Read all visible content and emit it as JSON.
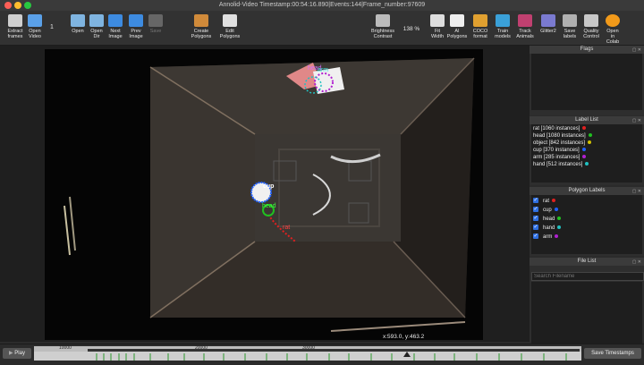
{
  "window": {
    "title": "Annolid-Video Timestamp:00:54:16.890|Events:144|Frame_number:97609"
  },
  "toolbar": {
    "extract_frames": "Extract\nframes",
    "open_video": "Open\nVideo",
    "frame_step": "1",
    "open": "Open",
    "open_dir": "Open\nDir",
    "next_image": "Next\nImage",
    "prev_image": "Prev\nImage",
    "save": "Save",
    "create_polygons": "Create\nPolygons",
    "edit_polygons": "Edit\nPolygons",
    "brightness_contrast": "Brightness\nContrast",
    "zoom": "138 %",
    "fit_width": "Fit\nWidth",
    "ai_polygons": "AI\nPolygons",
    "coco_format": "COCO\nformat",
    "train_models": "Train\nmodels",
    "track_animals": "Track\nAnimals",
    "glitter2": "Glitter2",
    "save_labels": "Save\nlabels",
    "quality_control": "Quality\nControl",
    "open_in_colab": "Open\nin\nColab"
  },
  "canvas": {
    "labels": {
      "head": "head",
      "cup": "cup",
      "rat": "rat",
      "arm": "arm"
    },
    "coords": "x:593.0, y:463.2"
  },
  "docks": {
    "flags": {
      "title": "Flags"
    },
    "label_list": {
      "title": "Label List",
      "items": [
        {
          "text": "rat [1060 instances]",
          "color": "#e02020"
        },
        {
          "text": "head [1080 instances]",
          "color": "#20c020"
        },
        {
          "text": "object [842 instances]",
          "color": "#d0c000"
        },
        {
          "text": "cup [370 instances]",
          "color": "#2060ff"
        },
        {
          "text": "arm [285 instances]",
          "color": "#b020d0"
        },
        {
          "text": "hand [512 instances]",
          "color": "#20c0c0"
        }
      ]
    },
    "polygon_labels": {
      "title": "Polygon Labels",
      "items": [
        {
          "text": "rat",
          "color": "#e02020"
        },
        {
          "text": "cup",
          "color": "#2060ff"
        },
        {
          "text": "head",
          "color": "#20c020"
        },
        {
          "text": "hand",
          "color": "#20c0c0"
        },
        {
          "text": "arm",
          "color": "#b020d0"
        }
      ]
    },
    "file_list": {
      "title": "File List",
      "search_placeholder": "Search Filename"
    }
  },
  "bottom": {
    "play": "Play",
    "save_timestamps": "Save Timestamps",
    "ticks": [
      "10000",
      "20000",
      "30000"
    ]
  }
}
